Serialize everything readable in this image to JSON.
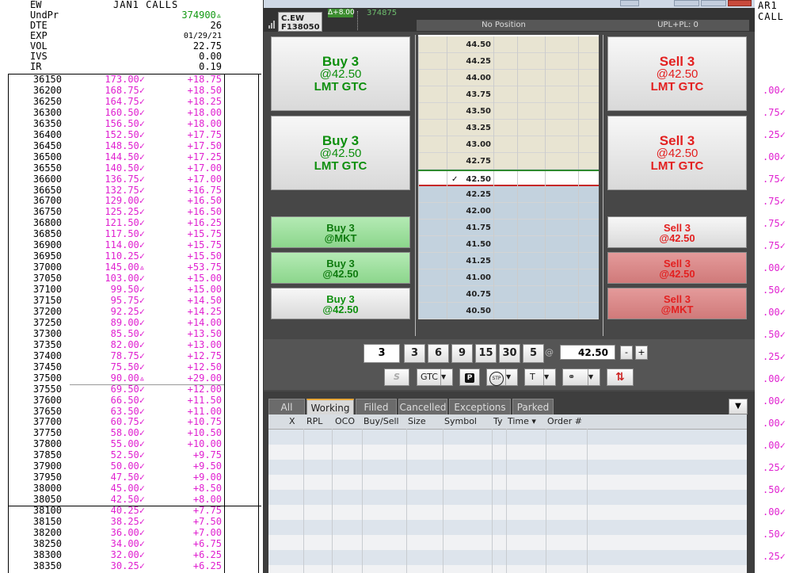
{
  "chain": {
    "header": {
      "symbol": "EW",
      "title": "JAN1 CALLS",
      "rows": [
        {
          "label": "UndPr",
          "value": "374900▵"
        },
        {
          "label": "DTE",
          "value": "26"
        },
        {
          "label": "EXP",
          "value": "01/29/21"
        },
        {
          "label": "VOL",
          "value": "22.75"
        },
        {
          "label": "IVS",
          "value": "0.00"
        },
        {
          "label": "IR",
          "value": "0.19"
        }
      ]
    },
    "rows": [
      {
        "strike": "36150",
        "price": "173.00✓",
        "change": "+18.75"
      },
      {
        "strike": "36200",
        "price": "168.75✓",
        "change": "+18.50"
      },
      {
        "strike": "36250",
        "price": "164.75✓",
        "change": "+18.25"
      },
      {
        "strike": "36300",
        "price": "160.50✓",
        "change": "+18.00"
      },
      {
        "strike": "36350",
        "price": "156.50✓",
        "change": "+18.00"
      },
      {
        "strike": "36400",
        "price": "152.50✓",
        "change": "+17.75"
      },
      {
        "strike": "36450",
        "price": "148.50✓",
        "change": "+17.50"
      },
      {
        "strike": "36500",
        "price": "144.50✓",
        "change": "+17.25"
      },
      {
        "strike": "36550",
        "price": "140.50✓",
        "change": "+17.00"
      },
      {
        "strike": "36600",
        "price": "136.75✓",
        "change": "+17.00"
      },
      {
        "strike": "36650",
        "price": "132.75✓",
        "change": "+16.75"
      },
      {
        "strike": "36700",
        "price": "129.00✓",
        "change": "+16.50"
      },
      {
        "strike": "36750",
        "price": "125.25✓",
        "change": "+16.50"
      },
      {
        "strike": "36800",
        "price": "121.50✓",
        "change": "+16.25"
      },
      {
        "strike": "36850",
        "price": "117.50✓",
        "change": "+15.75"
      },
      {
        "strike": "36900",
        "price": "114.00✓",
        "change": "+15.75"
      },
      {
        "strike": "36950",
        "price": "110.25✓",
        "change": "+15.50"
      },
      {
        "strike": "37000",
        "price": "145.00▵",
        "change": "+53.75"
      },
      {
        "strike": "37050",
        "price": "103.00✓",
        "change": "+15.00"
      },
      {
        "strike": "37100",
        "price": "99.50✓",
        "change": "+15.00"
      },
      {
        "strike": "37150",
        "price": "95.75✓",
        "change": "+14.50"
      },
      {
        "strike": "37200",
        "price": "92.25✓",
        "change": "+14.25"
      },
      {
        "strike": "37250",
        "price": "89.00✓",
        "change": "+14.00"
      },
      {
        "strike": "37300",
        "price": "85.50✓",
        "change": "+13.50"
      },
      {
        "strike": "37350",
        "price": "82.00✓",
        "change": "+13.00"
      },
      {
        "strike": "37400",
        "price": "78.75✓",
        "change": "+12.75"
      },
      {
        "strike": "37450",
        "price": "75.50✓",
        "change": "+12.50"
      },
      {
        "strike": "37500",
        "price": "90.00▵",
        "change": "+29.00"
      },
      {
        "strike": "37550",
        "price": "69.50✓",
        "change": "+12.00"
      },
      {
        "strike": "37600",
        "price": "66.50✓",
        "change": "+11.50"
      },
      {
        "strike": "37650",
        "price": "63.50✓",
        "change": "+11.00"
      },
      {
        "strike": "37700",
        "price": "60.75✓",
        "change": "+10.75"
      },
      {
        "strike": "37750",
        "price": "58.00✓",
        "change": "+10.50"
      },
      {
        "strike": "37800",
        "price": "55.00✓",
        "change": "+10.00"
      },
      {
        "strike": "37850",
        "price": "52.50✓",
        "change": "+9.75"
      },
      {
        "strike": "37900",
        "price": "50.00✓",
        "change": "+9.50"
      },
      {
        "strike": "37950",
        "price": "47.50✓",
        "change": "+9.00"
      },
      {
        "strike": "38000",
        "price": "45.00✓",
        "change": "+8.50"
      },
      {
        "strike": "38050",
        "price": "42.50✓",
        "change": "+8.00"
      },
      {
        "strike": "38100",
        "price": "40.25✓",
        "change": "+7.75"
      },
      {
        "strike": "38150",
        "price": "38.25✓",
        "change": "+7.50"
      },
      {
        "strike": "38200",
        "price": "36.00✓",
        "change": "+7.00"
      },
      {
        "strike": "38250",
        "price": "34.00✓",
        "change": "+6.75"
      },
      {
        "strike": "38300",
        "price": "32.00✓",
        "change": "+6.25"
      },
      {
        "strike": "38350",
        "price": "30.25✓",
        "change": "+6.25"
      }
    ]
  },
  "right_sliver": {
    "title": "AR1 CALL",
    "values": [
      ".00✓",
      ".75✓",
      ".25✓",
      ".00✓",
      ".75✓",
      ".75✓",
      ".75✓",
      ".75✓",
      ".00✓",
      ".50✓",
      ".00✓",
      ".50✓",
      ".25✓",
      ".00✓",
      ".00✓",
      ".00✓",
      ".00✓",
      ".25✓",
      ".50✓",
      ".00✓",
      ".50✓",
      ".25✓"
    ]
  },
  "order_window": {
    "symbol_line1": "C.EW",
    "symbol_line2": "F138050",
    "change_badge": "Δ+8.00",
    "last_price": "374875",
    "position": "No Position",
    "upl": "UPL+PL: 0",
    "buy_big": [
      {
        "line1": "Buy 3",
        "line2": "@42.50",
        "line3": "LMT GTC"
      },
      {
        "line1": "Buy 3",
        "line2": "@42.50",
        "line3": "LMT GTC"
      }
    ],
    "sell_big": [
      {
        "line1": "Sell 3",
        "line2": "@42.50",
        "line3": "LMT GTC"
      },
      {
        "line1": "Sell 3",
        "line2": "@42.50",
        "line3": "LMT GTC"
      }
    ],
    "buy_small": [
      {
        "line1": "Buy 3",
        "line2": "@MKT"
      },
      {
        "line1": "Buy 3",
        "line2": "@42.50"
      },
      {
        "line1": "Buy 3",
        "line2": "@42.50"
      }
    ],
    "sell_small": [
      {
        "line1": "Sell 3",
        "line2": "@42.50"
      },
      {
        "line1": "Sell 3",
        "line2": "@42.50"
      },
      {
        "line1": "Sell 3",
        "line2": "@MKT"
      }
    ],
    "ladder": {
      "prices": [
        "44.50",
        "44.25",
        "44.00",
        "43.75",
        "43.50",
        "43.25",
        "43.00",
        "42.75",
        "42.50",
        "42.25",
        "42.00",
        "41.75",
        "41.50",
        "41.25",
        "41.00",
        "40.75",
        "40.50"
      ],
      "current_index": 8,
      "check": "✓"
    },
    "qty": {
      "value": "3",
      "presets": [
        "3",
        "6",
        "9",
        "15",
        "30",
        "5"
      ],
      "at": "@",
      "price": "42.50",
      "minus": "-",
      "plus": "+"
    },
    "toolbar": {
      "s_label": "S",
      "tif": "GTC",
      "p_label": "P",
      "stp_label": "STP",
      "t_label": "T",
      "link_label": "⚭",
      "swap_label": "⇅"
    },
    "tabs": [
      "All",
      "Working",
      "Filled",
      "Cancelled",
      "Exceptions",
      "Parked"
    ],
    "active_tab": 1,
    "columns": [
      "X",
      "RPL",
      "OCO",
      "Buy/Sell",
      "Size",
      "Symbol",
      "Ty",
      "Time ▾",
      "Order #"
    ]
  }
}
